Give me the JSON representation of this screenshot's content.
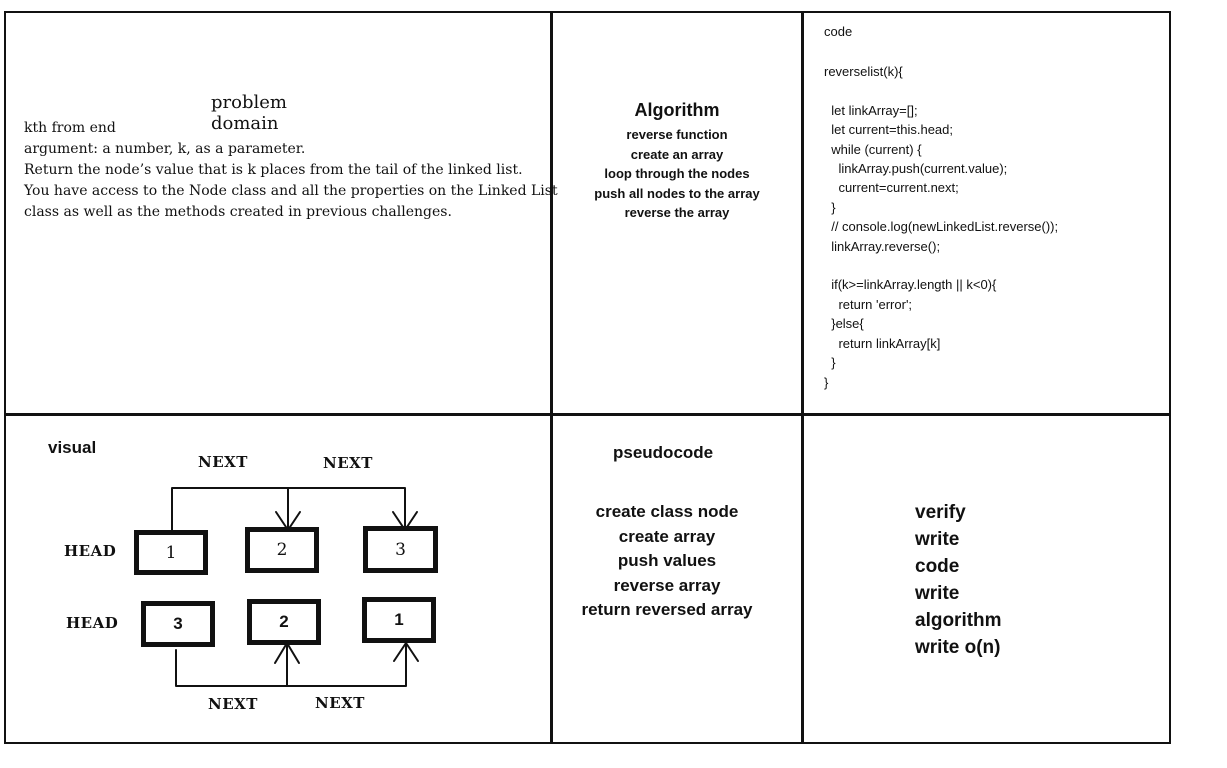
{
  "problem_domain": {
    "title": "problem domain",
    "lines": [
      "kth from end",
      "argument: a number, k, as a parameter.",
      "Return the node’s value that is k places from the tail of the linked list.",
      "You have access to the Node class and all the properties on the Linked List",
      "class as well as the methods created in previous challenges."
    ]
  },
  "algorithm": {
    "title": "Algorithm",
    "steps": [
      "reverse function",
      "create an array",
      "loop through the nodes",
      "push all nodes to the array",
      "reverse the array"
    ]
  },
  "code": {
    "title": "code",
    "lines": [
      "reverselist(k){",
      "",
      "  let linkArray=[];",
      "  let current=this.head;",
      "  while (current) {",
      "    linkArray.push(current.value);",
      "    current=current.next;",
      "  }",
      "  // console.log(newLinkedList.reverse());",
      "  linkArray.reverse();",
      "",
      "  if(k>=linkArray.length || k<0){",
      "    return 'error';",
      "  }else{",
      "    return linkArray[k]",
      "  }",
      "}"
    ]
  },
  "visual": {
    "title": "visual",
    "top_list": {
      "head_label": "HEAD",
      "next_labels": [
        "NEXT",
        "NEXT"
      ],
      "nodes": [
        "1",
        "2",
        "3"
      ]
    },
    "bottom_list": {
      "head_label": "HEAD",
      "next_labels": [
        "NEXT",
        "NEXT"
      ],
      "nodes": [
        "3",
        "2",
        "1"
      ]
    }
  },
  "pseudocode": {
    "title": "pseudocode",
    "steps": [
      "create class node",
      "create array",
      "push values",
      "reverse array",
      "return reversed array"
    ]
  },
  "verify": {
    "items": [
      "verify",
      "write code",
      "write algorithm",
      "write o(n)"
    ]
  }
}
